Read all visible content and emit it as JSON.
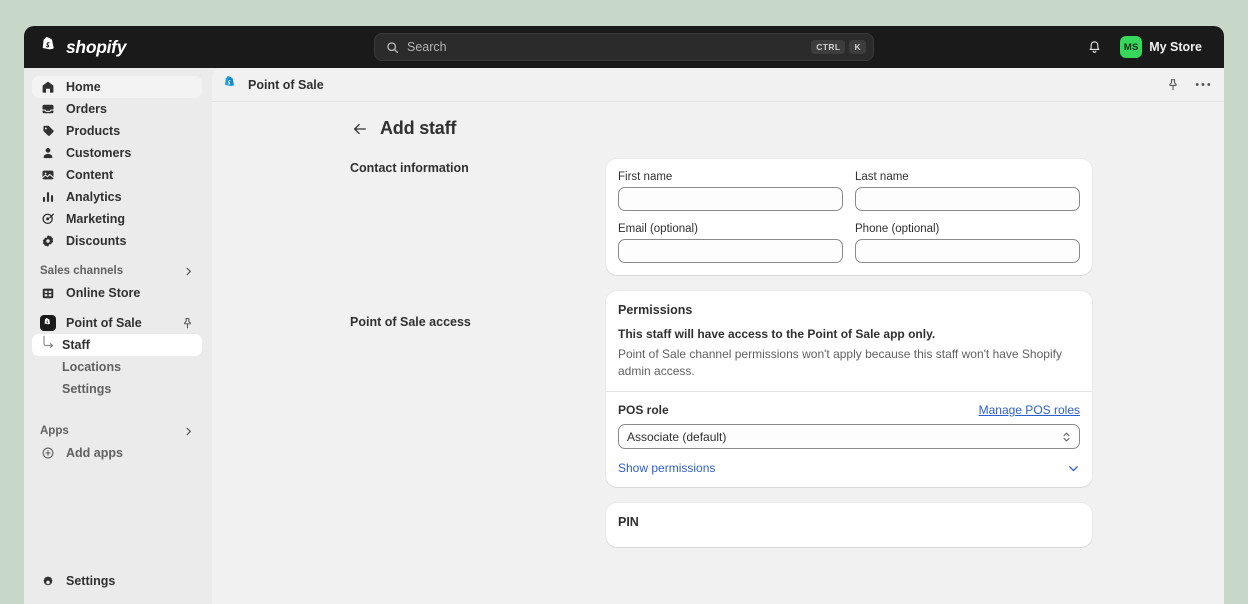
{
  "theme": {
    "page_background": "#c8d8c8",
    "topbar_background": "#1a1a1a",
    "sidebar_background": "#ebebeb",
    "main_background": "#f1f1f1",
    "accent_link": "#2c5ecf",
    "avatar_green": "#36d75b",
    "pos_icon_blue": "#1e9ee8"
  },
  "topbar": {
    "brand_name": "shopify",
    "brand_icon": "shopify-bag-icon",
    "search": {
      "placeholder": "Search",
      "icon": "search-icon",
      "shortcut_modifier": "CTRL",
      "shortcut_key": "K"
    },
    "notifications_icon": "bell-icon",
    "store": {
      "initials": "MS",
      "name": "My Store"
    }
  },
  "sidebar": {
    "primary_items": [
      {
        "label": "Home",
        "icon": "home-icon",
        "active": true
      },
      {
        "label": "Orders",
        "icon": "orders-icon",
        "active": false
      },
      {
        "label": "Products",
        "icon": "tag-icon",
        "active": false
      },
      {
        "label": "Customers",
        "icon": "person-icon",
        "active": false
      },
      {
        "label": "Content",
        "icon": "content-icon",
        "active": false
      },
      {
        "label": "Analytics",
        "icon": "bar-chart-icon",
        "active": false
      },
      {
        "label": "Marketing",
        "icon": "megaphone-target-icon",
        "active": false
      },
      {
        "label": "Discounts",
        "icon": "discount-icon",
        "active": false
      }
    ],
    "sales_channels": {
      "heading": "Sales channels",
      "collapse_icon": "chevron-right-icon",
      "items": [
        {
          "label": "Online Store",
          "icon": "storefront-icon"
        }
      ],
      "point_of_sale": {
        "label": "Point of Sale",
        "icon": "pos-app-icon",
        "pin_icon": "pin-icon",
        "children": [
          {
            "label": "Staff",
            "active": true
          },
          {
            "label": "Locations",
            "active": false
          },
          {
            "label": "Settings",
            "active": false
          }
        ]
      }
    },
    "apps": {
      "heading": "Apps",
      "collapse_icon": "chevron-right-icon",
      "items": [
        {
          "label": "Add apps",
          "icon": "plus-circle-icon"
        }
      ]
    },
    "settings": {
      "label": "Settings",
      "icon": "gear-icon"
    }
  },
  "app_bar": {
    "icon": "pos-shopify-bag-icon",
    "title": "Point of Sale",
    "pin_icon": "pin-icon",
    "more_icon": "ellipsis-icon"
  },
  "page": {
    "back_icon": "arrow-left-icon",
    "title": "Add staff",
    "sections": [
      {
        "label": "Contact information",
        "card": {
          "fields": [
            {
              "label": "First name",
              "value": "",
              "placeholder": ""
            },
            {
              "label": "Last name",
              "value": "",
              "placeholder": ""
            },
            {
              "label": "Email (optional)",
              "value": "",
              "placeholder": ""
            },
            {
              "label": "Phone (optional)",
              "value": "",
              "placeholder": ""
            }
          ]
        }
      },
      {
        "label": "Point of Sale access",
        "permissions_card": {
          "title": "Permissions",
          "primary_text": "This staff will have access to the Point of Sale app only.",
          "secondary_text": "Point of Sale channel permissions won't apply because this staff won't have Shopify admin access.",
          "role_label": "POS role",
          "manage_link": "Manage POS roles",
          "role_selected": "Associate (default)",
          "role_options": [
            "Associate (default)"
          ],
          "select_caret_icon": "select-caret-icon",
          "disclosure_label": "Show permissions",
          "disclosure_icon": "chevron-down-icon"
        },
        "pin_card": {
          "title": "PIN"
        }
      }
    ]
  }
}
